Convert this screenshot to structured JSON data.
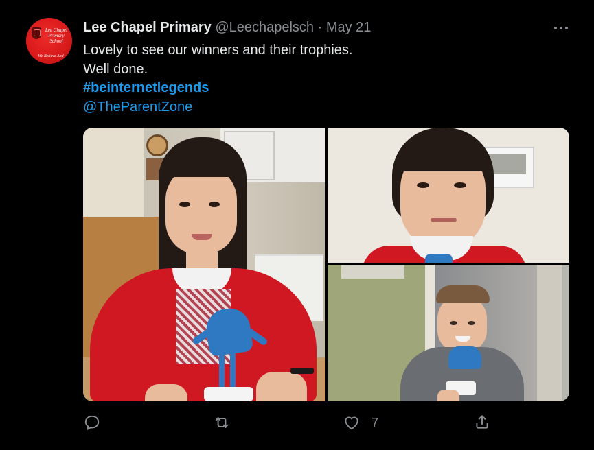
{
  "tweet": {
    "author_name": "Lee Chapel Primary",
    "author_handle": "@Leechapelsch",
    "separator": "·",
    "date": "May 21",
    "text_lines": [
      "Lovely to see our winners and their trophies.",
      "Well done.",
      "#beinternetlegends",
      "@TheParentZone"
    ],
    "likes": "7"
  },
  "avatar": {
    "logo_text_top": "Lee Chapel Primary School",
    "logo_text_bottom": "We Believe And"
  },
  "colors": {
    "background": "#000000",
    "text_primary": "#e7e9ea",
    "text_secondary": "#8b8f93",
    "link": "#1d9bf0",
    "avatar_red": "#d81a1a"
  },
  "icons": {
    "more": "more-icon",
    "reply": "reply-icon",
    "retweet": "retweet-icon",
    "like": "like-icon",
    "share": "share-icon"
  }
}
